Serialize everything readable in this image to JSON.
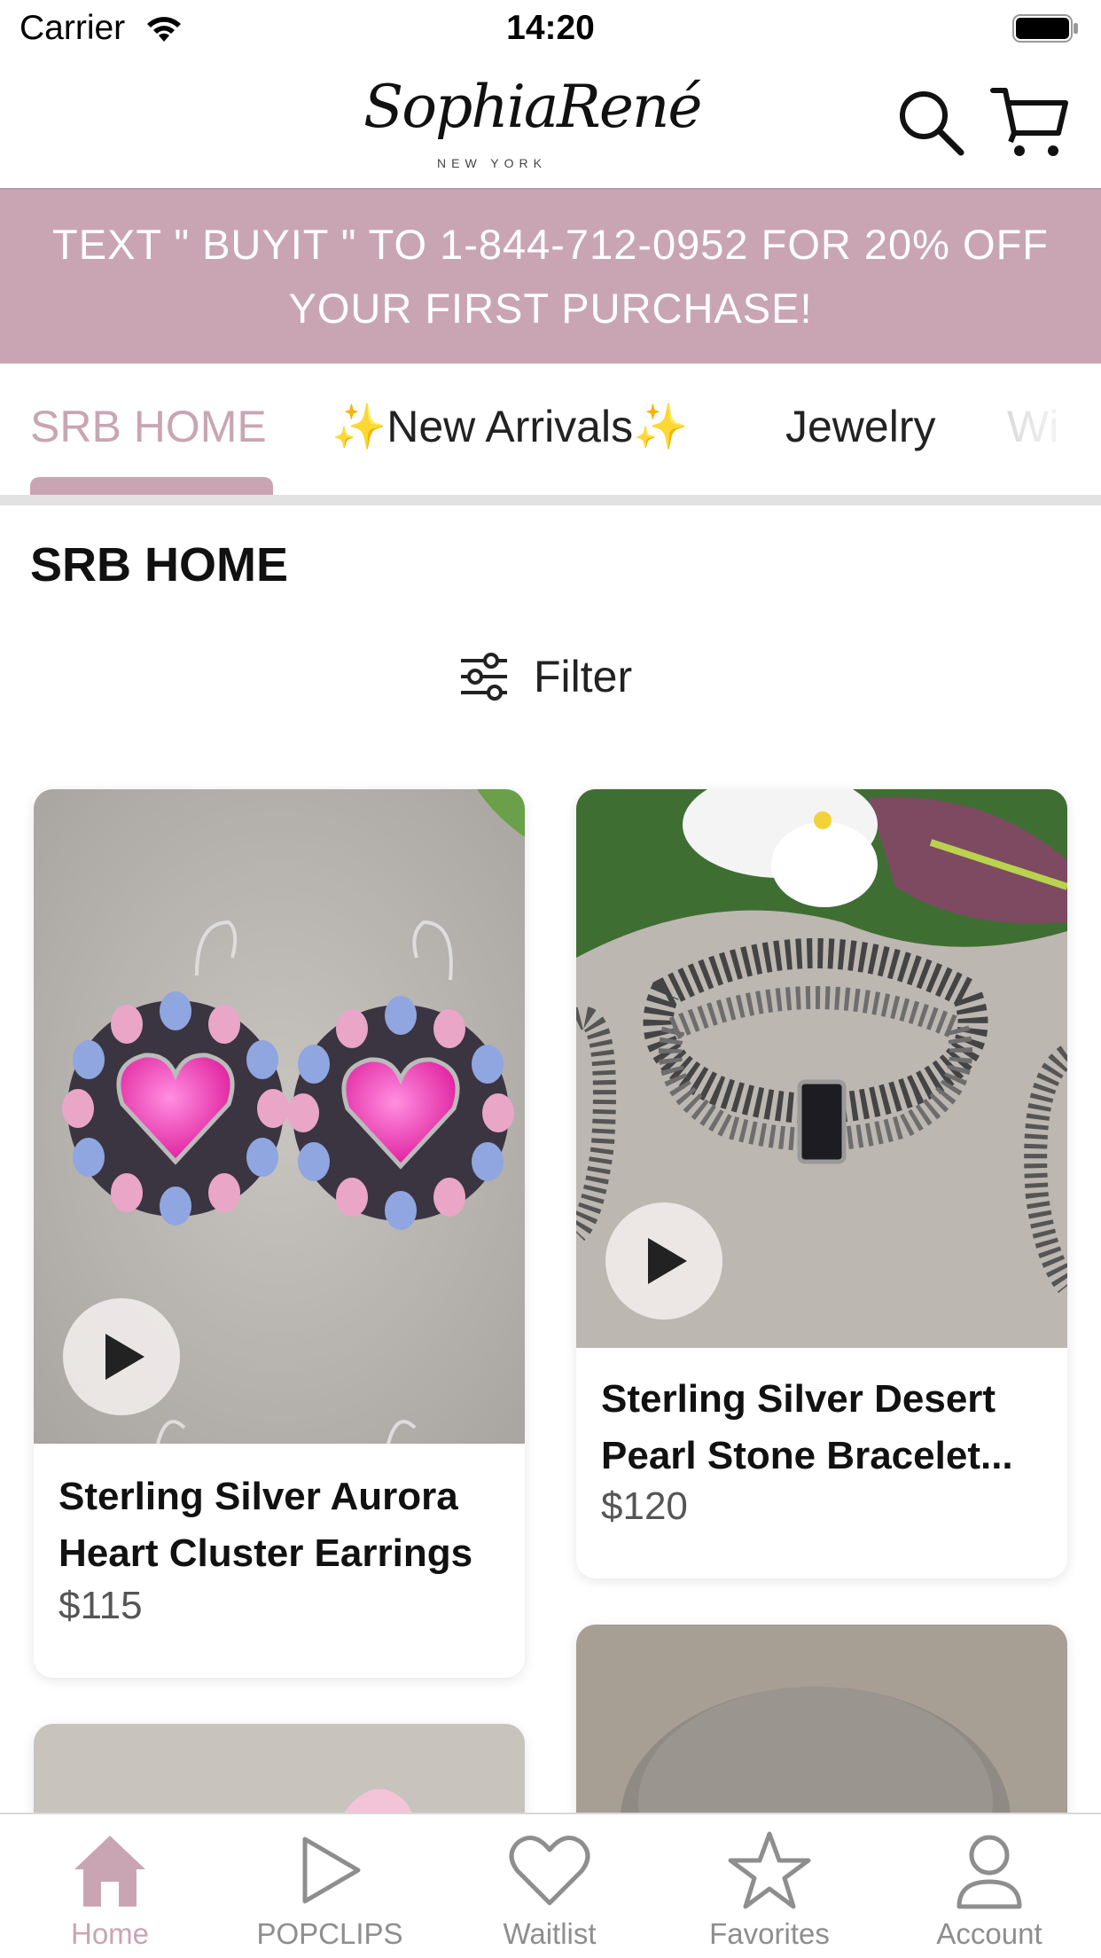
{
  "status_bar": {
    "carrier": "Carrier",
    "time": "14:20"
  },
  "header": {
    "logo_script": "SophiaRené",
    "logo_sub": "NEW YORK"
  },
  "promo": {
    "text": "TEXT \" BUYIT \" TO 1-844-712-0952 FOR 20% OFF YOUR FIRST PURCHASE!"
  },
  "tabs": [
    {
      "label": "SRB HOME",
      "active": true
    },
    {
      "label": "✨New Arrivals✨",
      "active": false
    },
    {
      "label": "Jewelry",
      "active": false
    },
    {
      "label": "Wi",
      "active": false
    }
  ],
  "page": {
    "title": "SRB HOME",
    "filter_label": "Filter"
  },
  "products": [
    {
      "name": "Sterling Silver Aurora Heart Cluster Earrings",
      "name_line1": "Sterling Silver Aurora",
      "name_line2": "Heart Cluster Earrings",
      "price": "$115",
      "has_video": true
    },
    {
      "name": "Sterling Silver Desert Pearl Stone Bracelet...",
      "name_line1": "Sterling Silver Desert",
      "name_line2": "Pearl Stone Bracelet...",
      "price": "$120",
      "has_video": true
    }
  ],
  "tabbar": [
    {
      "label": "Home",
      "icon": "home-icon",
      "active": true
    },
    {
      "label": "POPCLIPS",
      "icon": "play-icon",
      "active": false
    },
    {
      "label": "Waitlist",
      "icon": "heart-icon",
      "active": false
    },
    {
      "label": "Favorites",
      "icon": "star-icon",
      "active": false
    },
    {
      "label": "Account",
      "icon": "person-icon",
      "active": false
    }
  ],
  "colors": {
    "accent": "#c9a5b3",
    "inactive": "#8e8e8e"
  }
}
